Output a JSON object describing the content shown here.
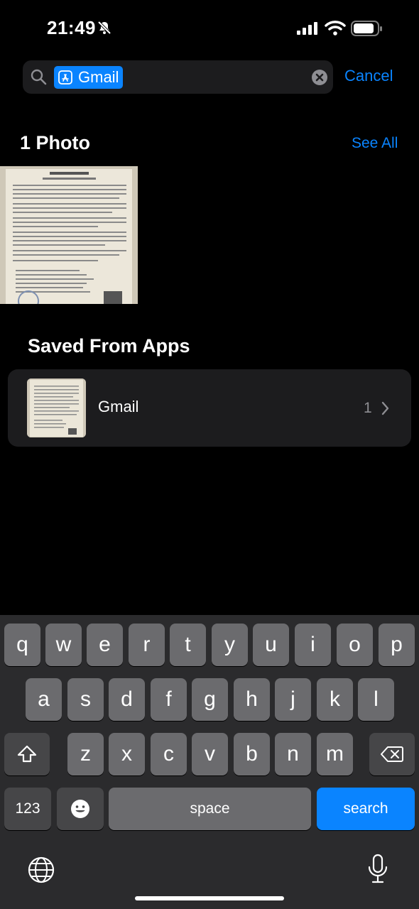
{
  "status_bar": {
    "time": "21:49"
  },
  "search": {
    "token_label": "Gmail",
    "cancel_label": "Cancel"
  },
  "photos_section": {
    "title": "1 Photo",
    "see_all_label": "See All"
  },
  "saved_section": {
    "title": "Saved From Apps",
    "items": [
      {
        "name": "Gmail",
        "count": "1"
      }
    ]
  },
  "keyboard": {
    "row1": [
      "q",
      "w",
      "e",
      "r",
      "t",
      "y",
      "u",
      "i",
      "o",
      "p"
    ],
    "row2": [
      "a",
      "s",
      "d",
      "f",
      "g",
      "h",
      "j",
      "k",
      "l"
    ],
    "row3": [
      "z",
      "x",
      "c",
      "v",
      "b",
      "n",
      "m"
    ],
    "numbers_label": "123",
    "space_label": "space",
    "search_label": "search"
  },
  "colors": {
    "accent": "#0a84ff",
    "background": "#000000",
    "card": "#1c1c1e"
  }
}
